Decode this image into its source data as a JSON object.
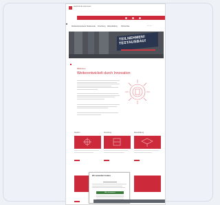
{
  "header": {
    "logo_text": "Hochschule Hannover",
    "nav": [
      "Studieninteressierte",
      "Studierende",
      "Forschung",
      "Weiterbildung",
      "Hochschule"
    ],
    "meta": "de | en"
  },
  "hero": {
    "banner_line1": "TEILNEHMEN!",
    "banner_line2": "TESTAUSBAU!"
  },
  "main": {
    "kicker": "Willkommen",
    "headline": "Weiterentwickelt durch Innovation"
  },
  "sections": [
    {
      "title": "Studium"
    },
    {
      "title": "Forschung"
    },
    {
      "title": "Weiterbildung"
    }
  ],
  "cookie": {
    "title": "Wir verwenden Cookies",
    "accept_label": "Alle akzeptieren"
  },
  "colors": {
    "brand": "#cc2a3a",
    "banner": "#2a3650",
    "hero_bg": "#4f5359"
  }
}
